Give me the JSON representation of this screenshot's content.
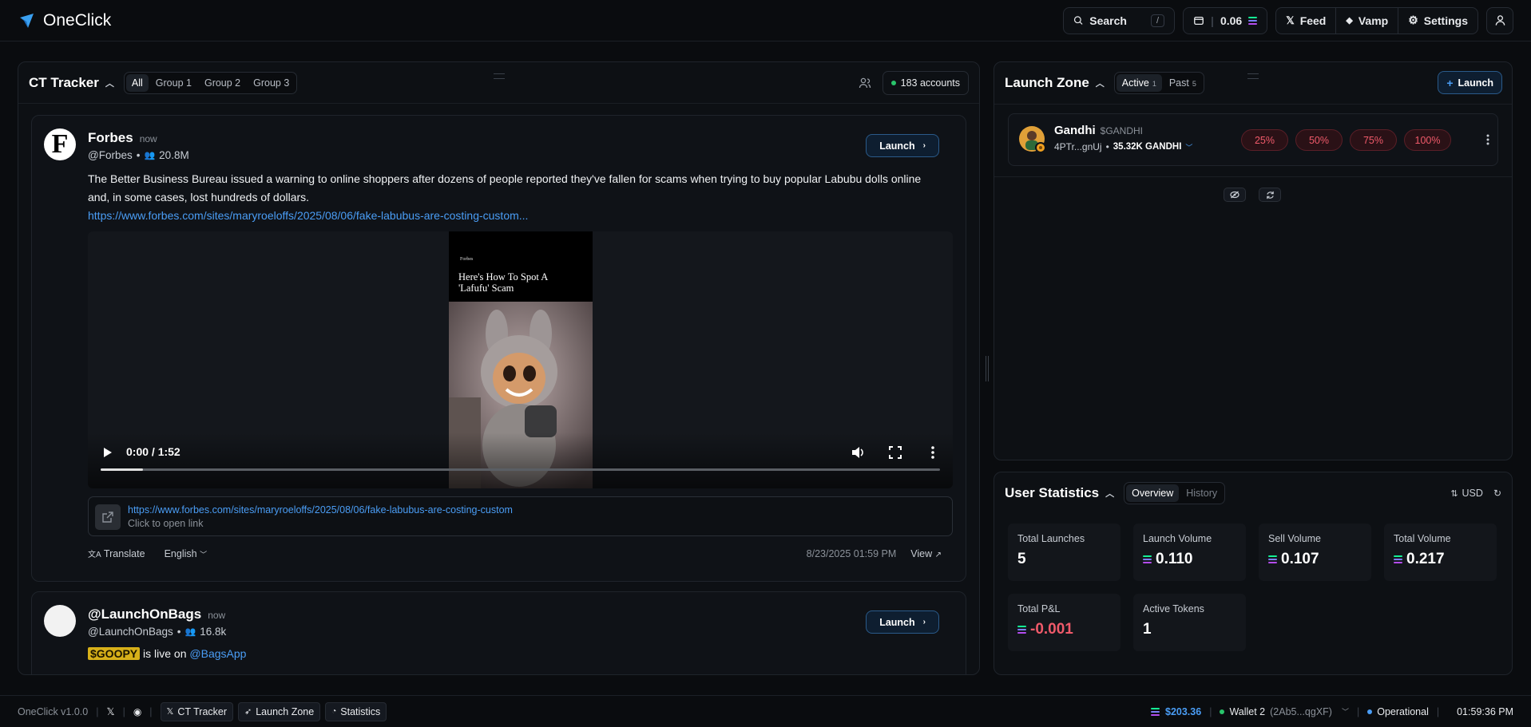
{
  "app": {
    "name": "OneClick"
  },
  "header": {
    "search_label": "Search",
    "search_kbd": "/",
    "balance": "0.06",
    "nav": [
      {
        "label": "Feed"
      },
      {
        "label": "Vamp"
      },
      {
        "label": "Settings"
      }
    ]
  },
  "ct_tracker": {
    "title": "CT Tracker",
    "tabs": [
      "All",
      "Group 1",
      "Group 2",
      "Group 3"
    ],
    "accounts": "183 accounts",
    "posts": [
      {
        "name": "Forbes",
        "time": "now",
        "handle": "@Forbes",
        "followers": "20.8M",
        "avatar_letter": "F",
        "launch": "Launch",
        "text": "The Better Business Bureau issued a warning to online shoppers after dozens of people reported they've fallen for scams when trying to buy popular Labubu dolls online and, in some cases, lost hundreds of dollars.",
        "link": "https://www.forbes.com/sites/maryroeloffs/2025/08/06/fake-labubus-are-costing-custom...",
        "video": {
          "brand": "Forbes",
          "title": "Here's How To Spot A 'Lafufu' Scam",
          "time": "0:00 / 1:52",
          "progress": 0.05
        },
        "link_card_url": "https://www.forbes.com/sites/maryroeloffs/2025/08/06/fake-labubus-are-costing-custom",
        "link_card_sub": "Click to open link",
        "translate": "Translate",
        "language": "English",
        "date": "8/23/2025 01:59 PM",
        "view": "View"
      },
      {
        "name": "@LaunchOnBags",
        "time": "now",
        "handle": "@LaunchOnBags",
        "followers": "16.8k",
        "launch": "Launch",
        "ticker": "$GOOPY",
        "text_mid": " is live on ",
        "mention": "@BagsApp"
      }
    ]
  },
  "launch_zone": {
    "title": "Launch Zone",
    "tabs": [
      {
        "label": "Active",
        "count": "1"
      },
      {
        "label": "Past",
        "count": "5"
      }
    ],
    "launch_button": "Launch",
    "token": {
      "name": "Gandhi",
      "ticker": "$GANDHI",
      "address": "4PTr...gnUj",
      "amount": "35.32K GANDHI",
      "sell_options": [
        "25%",
        "50%",
        "75%",
        "100%"
      ]
    }
  },
  "user_stats": {
    "title": "User Statistics",
    "tabs": [
      "Overview",
      "History"
    ],
    "currency": "USD",
    "cards": [
      {
        "label": "Total Launches",
        "value": "5",
        "sol": false,
        "negative": false
      },
      {
        "label": "Launch Volume",
        "value": "0.110",
        "sol": true,
        "negative": false
      },
      {
        "label": "Sell Volume",
        "value": "0.107",
        "sol": true,
        "negative": false
      },
      {
        "label": "Total Volume",
        "value": "0.217",
        "sol": true,
        "negative": false
      },
      {
        "label": "Total P&L",
        "value": "-0.001",
        "sol": true,
        "negative": true
      },
      {
        "label": "Active Tokens",
        "value": "1",
        "sol": false,
        "negative": false
      }
    ]
  },
  "footer": {
    "version": "OneClick v1.0.0",
    "chips": [
      "CT Tracker",
      "Launch Zone",
      "Statistics"
    ],
    "sol_price": "$203.36",
    "wallet_name": "Wallet 2",
    "wallet_addr": "(2Ab5...qgXF)",
    "status": "Operational",
    "clock": "01:59:36 PM"
  },
  "colors": {
    "accent": "#4a9df5",
    "sell": "#f05a6a",
    "online": "#29c46b",
    "ticker": "#d7b019"
  }
}
